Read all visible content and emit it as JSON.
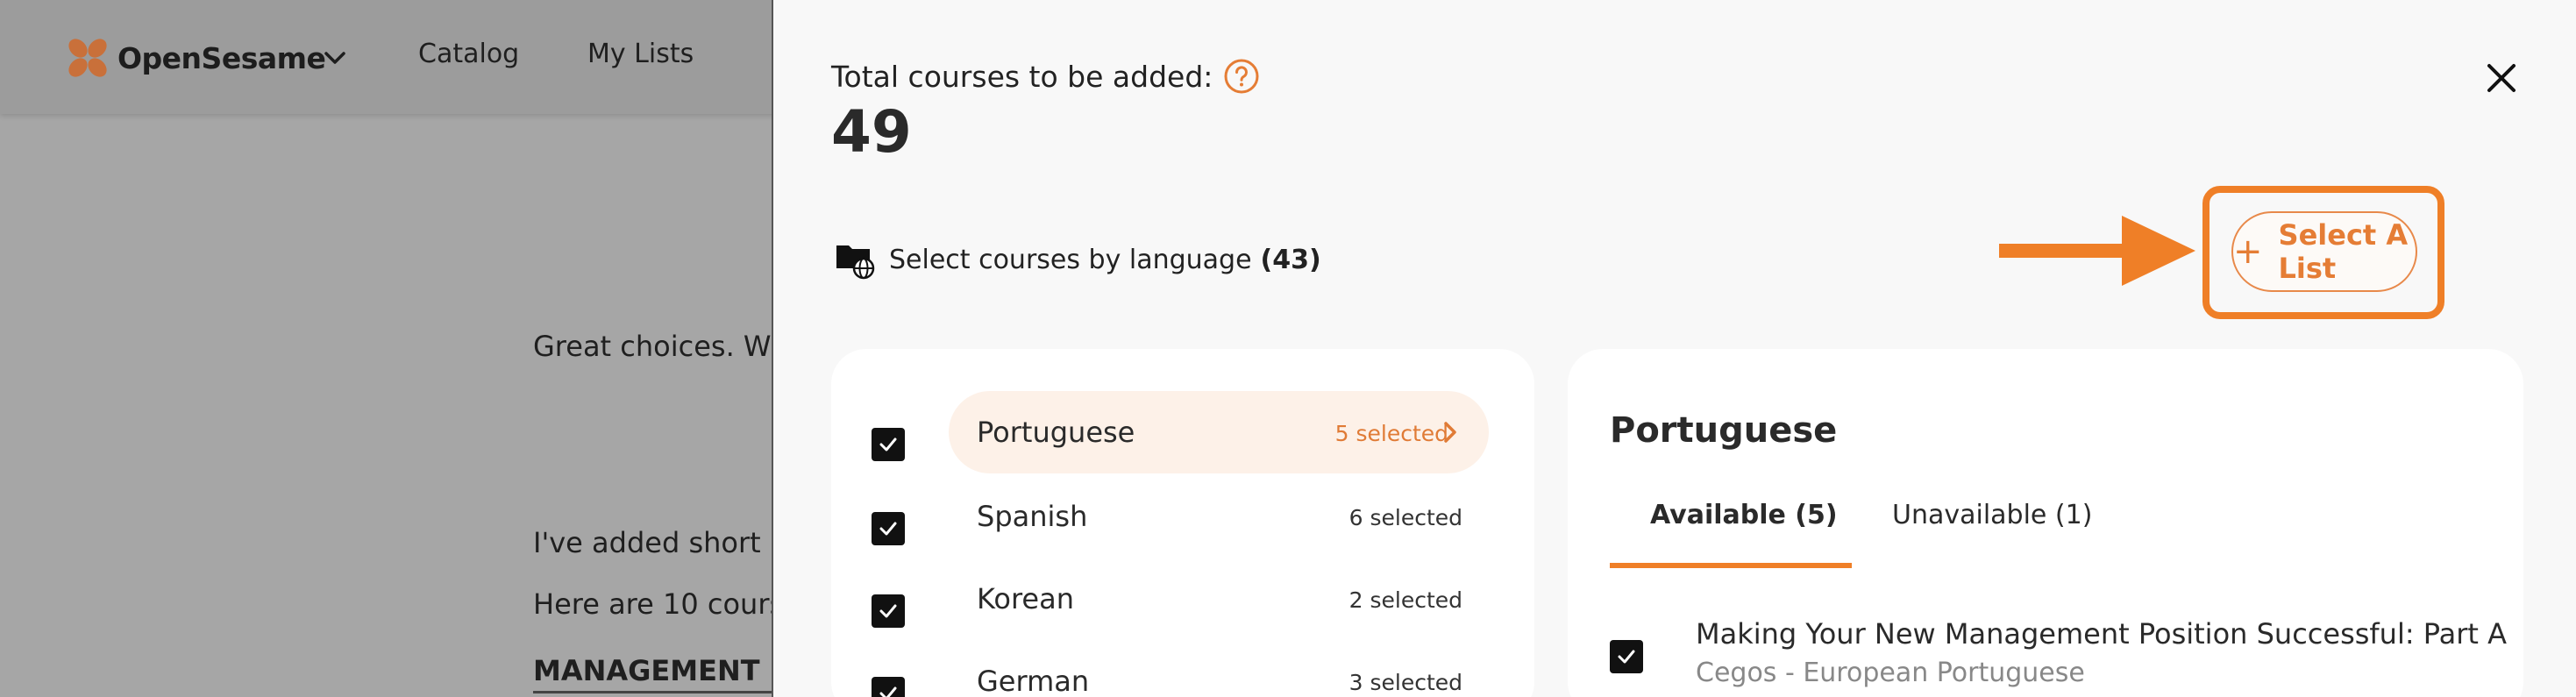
{
  "app": {
    "brand": "OpenSesame",
    "nav": [
      "Catalog",
      "My Lists"
    ]
  },
  "background": {
    "lines": [
      "Great choices. W",
      "I've added short",
      "Here are 10 cours"
    ],
    "heading": "MANAGEMENT"
  },
  "drawer": {
    "total_label": "Total courses to be added:",
    "total_count": "49",
    "select_by_language_label": "Select courses by language",
    "select_by_language_count": "(43)",
    "select_list_button": "Select A List",
    "languages": [
      {
        "name": "Portuguese",
        "selected": "5 selected",
        "checked": true,
        "active": true
      },
      {
        "name": "Spanish",
        "selected": "6 selected",
        "checked": true,
        "active": false
      },
      {
        "name": "Korean",
        "selected": "2 selected",
        "checked": true,
        "active": false
      },
      {
        "name": "German",
        "selected": "3 selected",
        "checked": true,
        "active": false
      }
    ],
    "detail": {
      "title": "Portuguese",
      "tabs": [
        {
          "label": "Available (5)",
          "active": true
        },
        {
          "label": "Unavailable (1)",
          "active": false
        }
      ],
      "courses": [
        {
          "title": "Making Your New Management Position Successful: Part A",
          "subtitle": "Cegos - European Portuguese",
          "checked": true
        }
      ]
    }
  },
  "colors": {
    "accent": "#ef7f27",
    "active_pill": "#fdf1e8"
  }
}
